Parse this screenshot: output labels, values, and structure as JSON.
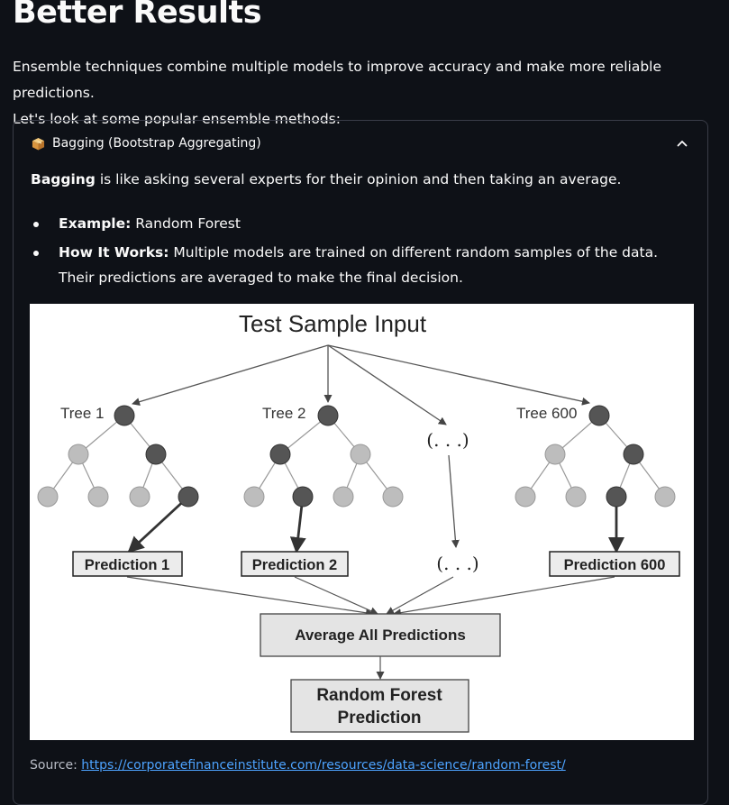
{
  "page": {
    "title": "Better Results",
    "intro_line1": "Ensemble techniques combine multiple models to improve accuracy and make more reliable predictions.",
    "intro_line2": "Let's look at some popular ensemble methods:"
  },
  "expander": {
    "icon": "package-icon",
    "label": "Bagging (Bootstrap Aggregating)",
    "chevron_icon": "chevron-up-icon",
    "lead_bold": "Bagging",
    "lead_rest": " is like asking several experts for their opinion and then taking an average.",
    "bullets": [
      {
        "bold": "Example:",
        "text": " Random Forest"
      },
      {
        "bold": "How It Works:",
        "text": " Multiple models are trained on different random samples of the data. Their predictions are averaged to make the final decision."
      }
    ],
    "source_label": "Source: ",
    "source_link": "https://corporatefinanceinstitute.com/resources/data-science/random-forest/"
  },
  "diagram": {
    "top": "Test Sample Input",
    "trees": [
      "Tree 1",
      "Tree 2",
      "Tree 600"
    ],
    "ellipsis": "(. . .)",
    "predictions": [
      "Prediction 1",
      "Prediction 2",
      "Prediction 600"
    ],
    "average": "Average All Predictions",
    "final_line1": "Random Forest",
    "final_line2": "Prediction"
  }
}
